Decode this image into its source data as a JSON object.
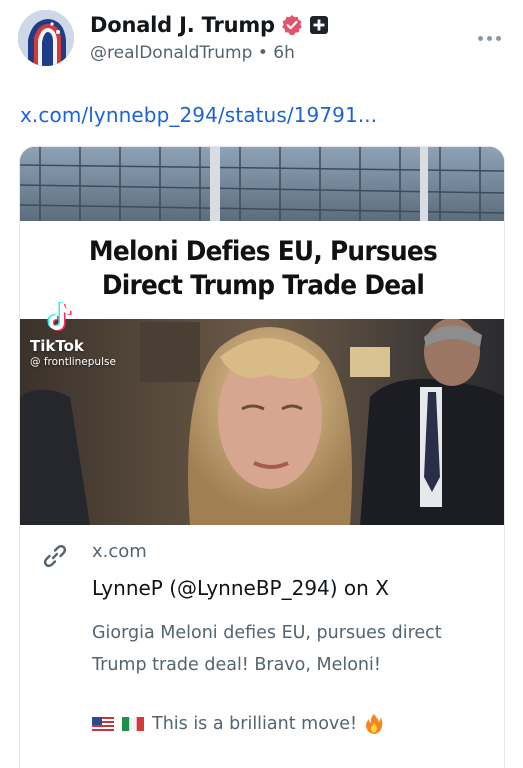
{
  "author": {
    "display_name": "Donald J. Trump",
    "handle": "@realDonaldTrump",
    "separator": "•",
    "time_ago": "6h",
    "verified_badge_color": "#e5506c"
  },
  "post": {
    "link_text": "x.com/lynnebp_294/status/19791..."
  },
  "card": {
    "video_headline_line1": "Meloni Defies EU, Pursues",
    "video_headline_line2": "Direct Trump Trade Deal",
    "watermark_brand": "TikTok",
    "watermark_user": "@ frontlinepulse",
    "domain": "x.com",
    "title": "LynneP (@LynneBP_294) on X",
    "description": "Giorgia Meloni defies EU, pursues direct Trump trade deal! Bravo, Meloni!",
    "description_tail": "This is a brilliant move!",
    "emoji_flag_us": "us-flag-icon",
    "emoji_flag_it": "italy-flag-icon",
    "emoji_fire": "fire-icon"
  },
  "colors": {
    "link": "#1d63d8",
    "secondary_text": "#536471"
  }
}
